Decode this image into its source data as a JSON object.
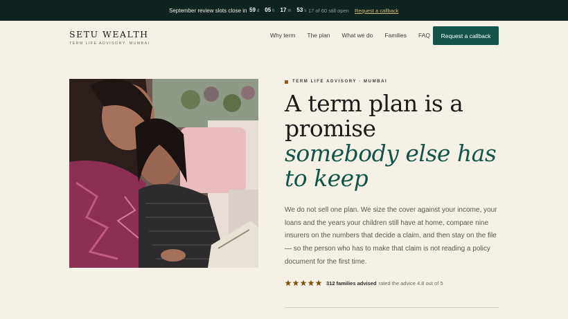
{
  "topbar": {
    "message": "September review slots close in",
    "countdown": [
      {
        "value": "59",
        "unit": "d"
      },
      {
        "value": "05",
        "unit": "h"
      },
      {
        "value": "17",
        "unit": "m"
      },
      {
        "value": "53",
        "unit": "s"
      }
    ],
    "slots": "17 of 60 still open",
    "callback_link": "Request a callback"
  },
  "brand": {
    "name": "SETU WEALTH",
    "tagline": "TERM LIFE ADVISORY, MUMBAI"
  },
  "nav": {
    "items": [
      "Why term",
      "The plan",
      "What we do",
      "Families",
      "FAQ"
    ],
    "cta": "Request a callback"
  },
  "hero": {
    "eyebrow": "TERM LIFE ADVISORY · MUMBAI",
    "headline_line1": "A term plan is a promise",
    "headline_emphasis": "somebody else has to keep",
    "body": "We do not sell one plan. We size the cover against your income, your loans and the years your children still have at home, compare nine insurers on the numbers that decide a claim, and then stay on the file — so the person who has to make that claim is not reading a policy document for the first time.",
    "rating": {
      "stars": 5,
      "families": "312 families advised",
      "text": "rated the advice 4.8 out of 5"
    }
  },
  "colors": {
    "background": "#f6f1e6",
    "topbar": "#0f2420",
    "accent_green": "#12544a",
    "accent_gold": "#d7b878",
    "star": "#7a5410",
    "eyebrow_dot": "#a0531f"
  }
}
